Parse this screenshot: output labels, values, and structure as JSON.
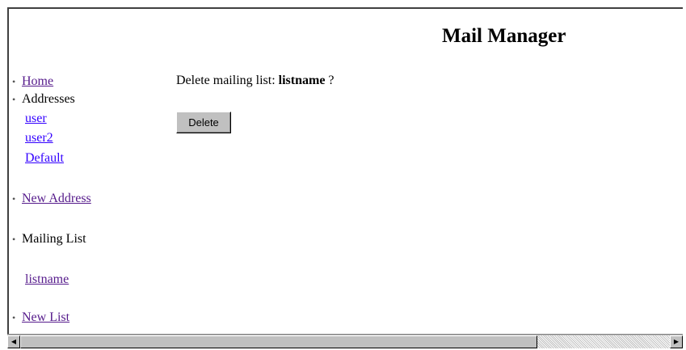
{
  "header": {
    "title": "Mail Manager"
  },
  "nav": {
    "home": "Home",
    "addresses": "Addresses",
    "address_items": [
      "user",
      "user2",
      "Default"
    ],
    "new_address": "New Address",
    "mailing_list": "Mailing List",
    "list_items": [
      "listname"
    ],
    "new_list": "New List"
  },
  "main": {
    "prompt_prefix": "Delete mailing list: ",
    "list_name": "listname",
    "prompt_suffix": " ?",
    "delete_label": "Delete"
  },
  "icons": {
    "bullet": "bullet-icon",
    "scroll_left": "arrow-left-icon",
    "scroll_right": "arrow-right-icon"
  }
}
